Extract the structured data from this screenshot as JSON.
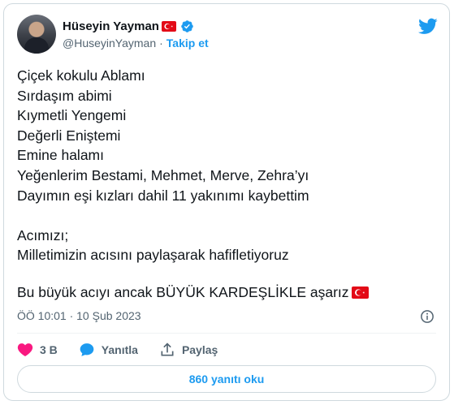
{
  "author": {
    "name": "Hüseyin Yayman",
    "handle": "@HuseyinYayman",
    "separator": "·",
    "follow_label": "Takip et"
  },
  "tweet": {
    "body": "Çiçek kokulu Ablamı\nSırdaşım abimi\nKıymetli Yengemi\nDeğerli Eniştemi\nEmine halamı\nYeğenlerim Bestami, Mehmet, Merve, Zehra’yı\nDayımın eşi kızları dahil 11 yakınımı kaybettim\n\nAcımızı;\nMilletimizin acısını paylaşarak hafifletiyoruz",
    "last_line": "Bu büyük acıyı ancak BÜYÜK KARDEŞLİKLE aşarız",
    "timestamp": "ÖÖ 10:01 · 10 Şub 2023"
  },
  "actions": {
    "like_count": "3 B",
    "reply_label": "Yanıtla",
    "share_label": "Paylaş"
  },
  "replies_button": "860 yanıtı oku",
  "icons": {
    "brand": "twitter-bird-icon",
    "verified": "verified-badge-icon",
    "flag": "turkey-flag-icon",
    "info": "info-icon",
    "like": "heart-icon",
    "reply": "speech-bubble-icon",
    "share": "share-icon"
  },
  "colors": {
    "accent": "#1d9bf0",
    "like": "#f91880",
    "flag_red": "#e30a17",
    "muted_text": "#536471"
  }
}
